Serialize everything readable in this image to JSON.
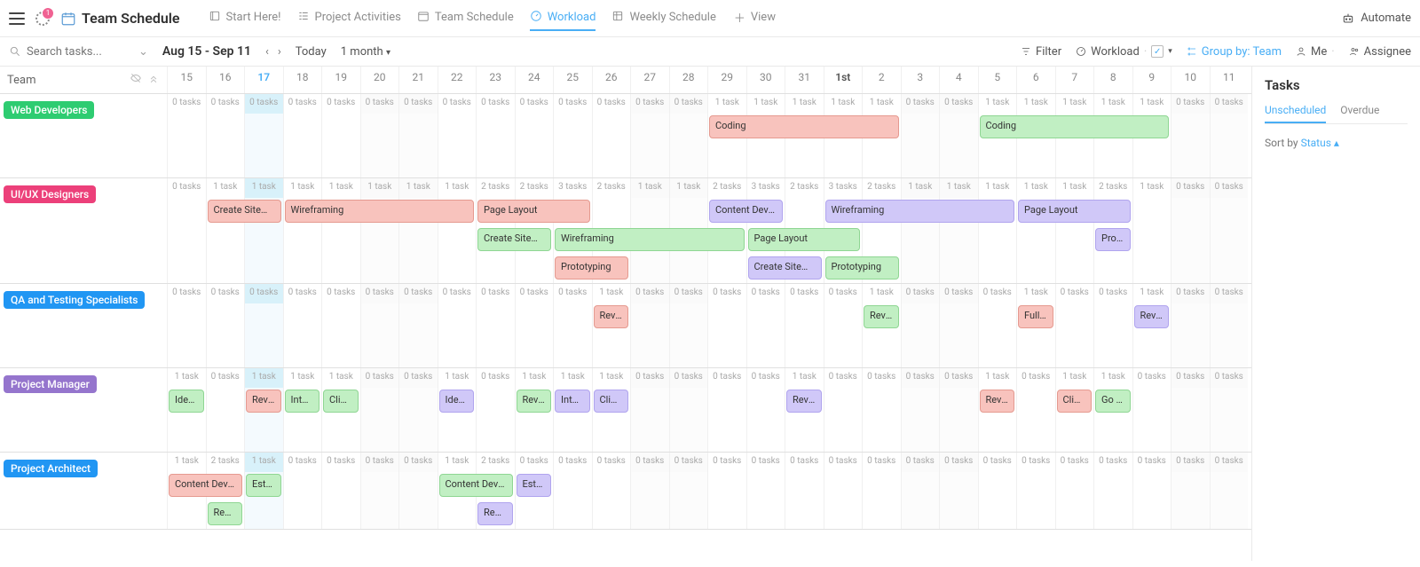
{
  "title": "Team Schedule",
  "badge_count": "1",
  "nav_tabs": [
    {
      "label": "Start Here!",
      "active": false
    },
    {
      "label": "Project Activities",
      "active": false
    },
    {
      "label": "Team Schedule",
      "active": false
    },
    {
      "label": "Workload",
      "active": true
    },
    {
      "label": "Weekly Schedule",
      "active": false
    }
  ],
  "add_view_label": "View",
  "automate_label": "Automate",
  "search_placeholder": "Search tasks...",
  "date_range": "Aug 15 - Sep 11",
  "today_label": "Today",
  "month_label": "1 month",
  "toolbar_right": {
    "filter": "Filter",
    "workload": "Workload",
    "group_by": "Group by: Team",
    "me": "Me",
    "assignee": "Assignee"
  },
  "team_header": "Team",
  "days": [
    "15",
    "16",
    "17",
    "18",
    "19",
    "20",
    "21",
    "22",
    "23",
    "24",
    "25",
    "26",
    "27",
    "28",
    "29",
    "30",
    "31",
    "1st",
    "2",
    "3",
    "4",
    "5",
    "6",
    "7",
    "8",
    "9",
    "10",
    "11"
  ],
  "today_index": 2,
  "month_start_index": 17,
  "weekend_indices": [
    5,
    6,
    12,
    13,
    19,
    20,
    26,
    27
  ],
  "teams": [
    {
      "name": "Web Developers",
      "color": "#2ecc71",
      "counts": [
        0,
        0,
        0,
        0,
        0,
        0,
        0,
        0,
        0,
        0,
        0,
        0,
        0,
        0,
        1,
        1,
        1,
        1,
        1,
        0,
        0,
        1,
        1,
        1,
        1,
        1,
        0,
        0
      ],
      "lanes": [
        [
          {
            "label": "Coding",
            "start": 14,
            "span": 5,
            "color": "#f8c3bd",
            "border": "#e59a90"
          },
          {
            "label": "Coding",
            "start": 21,
            "span": 5,
            "color": "#c1efc3",
            "border": "#8fd693"
          }
        ]
      ]
    },
    {
      "name": "UI/UX Designers",
      "color": "#ec407a",
      "counts": [
        0,
        1,
        1,
        1,
        1,
        1,
        1,
        1,
        2,
        2,
        3,
        2,
        1,
        1,
        2,
        3,
        2,
        3,
        2,
        1,
        1,
        1,
        1,
        1,
        2,
        1,
        0,
        0
      ],
      "lanes": [
        [
          {
            "label": "Create Sitemap",
            "start": 1,
            "span": 2,
            "color": "#f8c3bd",
            "border": "#e59a90"
          },
          {
            "label": "Wireframing",
            "start": 3,
            "span": 5,
            "color": "#f8c3bd",
            "border": "#e59a90"
          },
          {
            "label": "Page Layout",
            "start": 8,
            "span": 3,
            "color": "#f8c3bd",
            "border": "#e59a90"
          },
          {
            "label": "Content Devel...",
            "start": 14,
            "span": 2,
            "color": "#d0c8f8",
            "border": "#b0a4ee"
          },
          {
            "label": "Wireframing",
            "start": 17,
            "span": 5,
            "color": "#d0c8f8",
            "border": "#b0a4ee"
          },
          {
            "label": "Page Layout",
            "start": 22,
            "span": 3,
            "color": "#d0c8f8",
            "border": "#b0a4ee"
          }
        ],
        [
          {
            "label": "Create Sitemap",
            "start": 8,
            "span": 2,
            "color": "#c1efc3",
            "border": "#8fd693"
          },
          {
            "label": "Wireframing",
            "start": 10,
            "span": 5,
            "color": "#c1efc3",
            "border": "#8fd693"
          },
          {
            "label": "Page Layout",
            "start": 15,
            "span": 3,
            "color": "#c1efc3",
            "border": "#8fd693"
          },
          {
            "label": "Prototyping",
            "start": 24,
            "span": 1,
            "color": "#d0c8f8",
            "border": "#b0a4ee"
          }
        ],
        [
          {
            "label": "Prototyping",
            "start": 10,
            "span": 2,
            "color": "#f8c3bd",
            "border": "#e59a90"
          },
          {
            "label": "Create Sitemap",
            "start": 15,
            "span": 2,
            "color": "#d0c8f8",
            "border": "#b0a4ee"
          },
          {
            "label": "Prototyping",
            "start": 17,
            "span": 2,
            "color": "#c1efc3",
            "border": "#8fd693"
          }
        ]
      ]
    },
    {
      "name": "QA and Testing Specialists",
      "color": "#2196f3",
      "counts": [
        0,
        0,
        0,
        0,
        0,
        0,
        0,
        0,
        0,
        0,
        0,
        1,
        0,
        0,
        0,
        0,
        0,
        0,
        1,
        0,
        0,
        0,
        1,
        0,
        0,
        1,
        0,
        0
      ],
      "lanes": [
        [
          {
            "label": "Revie...",
            "start": 11,
            "span": 1,
            "color": "#f8c3bd",
            "border": "#e59a90"
          },
          {
            "label": "Revie...",
            "start": 18,
            "span": 1,
            "color": "#c1efc3",
            "border": "#8fd693"
          },
          {
            "label": "Full r...",
            "start": 22,
            "span": 1,
            "color": "#f8c3bd",
            "border": "#e59a90"
          },
          {
            "label": "Revi...",
            "start": 25,
            "span": 1,
            "color": "#d0c8f8",
            "border": "#b0a4ee"
          }
        ]
      ]
    },
    {
      "name": "Project Manager",
      "color": "#9575cd",
      "counts": [
        1,
        0,
        1,
        1,
        1,
        0,
        0,
        1,
        0,
        1,
        1,
        1,
        0,
        0,
        0,
        0,
        1,
        0,
        0,
        0,
        0,
        1,
        0,
        1,
        1,
        0,
        0,
        0
      ],
      "lanes": [
        [
          {
            "label": "Ident...",
            "start": 0,
            "span": 1,
            "color": "#c1efc3",
            "border": "#8fd693"
          },
          {
            "label": "Revie...",
            "start": 2,
            "span": 1,
            "color": "#f8c3bd",
            "border": "#e59a90"
          },
          {
            "label": "Inter...",
            "start": 3,
            "span": 1,
            "color": "#c1efc3",
            "border": "#8fd693"
          },
          {
            "label": "Clien...",
            "start": 4,
            "span": 1,
            "color": "#c1efc3",
            "border": "#8fd693"
          },
          {
            "label": "Ident...",
            "start": 7,
            "span": 1,
            "color": "#d0c8f8",
            "border": "#b0a4ee"
          },
          {
            "label": "Revie...",
            "start": 9,
            "span": 1,
            "color": "#c1efc3",
            "border": "#8fd693"
          },
          {
            "label": "Inter...",
            "start": 10,
            "span": 1,
            "color": "#d0c8f8",
            "border": "#b0a4ee"
          },
          {
            "label": "Clien...",
            "start": 11,
            "span": 1,
            "color": "#d0c8f8",
            "border": "#b0a4ee"
          },
          {
            "label": "Revie...",
            "start": 16,
            "span": 1,
            "color": "#d0c8f8",
            "border": "#b0a4ee"
          },
          {
            "label": "Revie...",
            "start": 21,
            "span": 1,
            "color": "#f8c3bd",
            "border": "#e59a90"
          },
          {
            "label": "Clien...",
            "start": 23,
            "span": 1,
            "color": "#f8c3bd",
            "border": "#e59a90"
          },
          {
            "label": "Go Li...",
            "start": 24,
            "span": 1,
            "color": "#c1efc3",
            "border": "#8fd693"
          }
        ]
      ]
    },
    {
      "name": "Project Architect",
      "color": "#2196f3",
      "counts": [
        1,
        2,
        1,
        0,
        0,
        0,
        0,
        1,
        2,
        0,
        0,
        0,
        0,
        0,
        0,
        0,
        0,
        0,
        0,
        0,
        0,
        0,
        0,
        0,
        0,
        0,
        0,
        0
      ],
      "lanes": [
        [
          {
            "label": "Content Devel...",
            "start": 0,
            "span": 2,
            "color": "#f8c3bd",
            "border": "#e59a90"
          },
          {
            "label": "Estab...",
            "start": 2,
            "span": 1,
            "color": "#c1efc3",
            "border": "#8fd693"
          },
          {
            "label": "Content Devel...",
            "start": 7,
            "span": 2,
            "color": "#c1efc3",
            "border": "#8fd693"
          },
          {
            "label": "Estab...",
            "start": 9,
            "span": 1,
            "color": "#d0c8f8",
            "border": "#b0a4ee"
          }
        ],
        [
          {
            "label": "Rese...",
            "start": 1,
            "span": 1,
            "color": "#c1efc3",
            "border": "#8fd693"
          },
          {
            "label": "Rese...",
            "start": 8,
            "span": 1,
            "color": "#d0c8f8",
            "border": "#b0a4ee"
          }
        ]
      ]
    }
  ],
  "side": {
    "title": "Tasks",
    "tabs": [
      "Unscheduled",
      "Overdue"
    ],
    "active_tab": 0,
    "sort_label": "Sort by",
    "sort_value": "Status"
  }
}
